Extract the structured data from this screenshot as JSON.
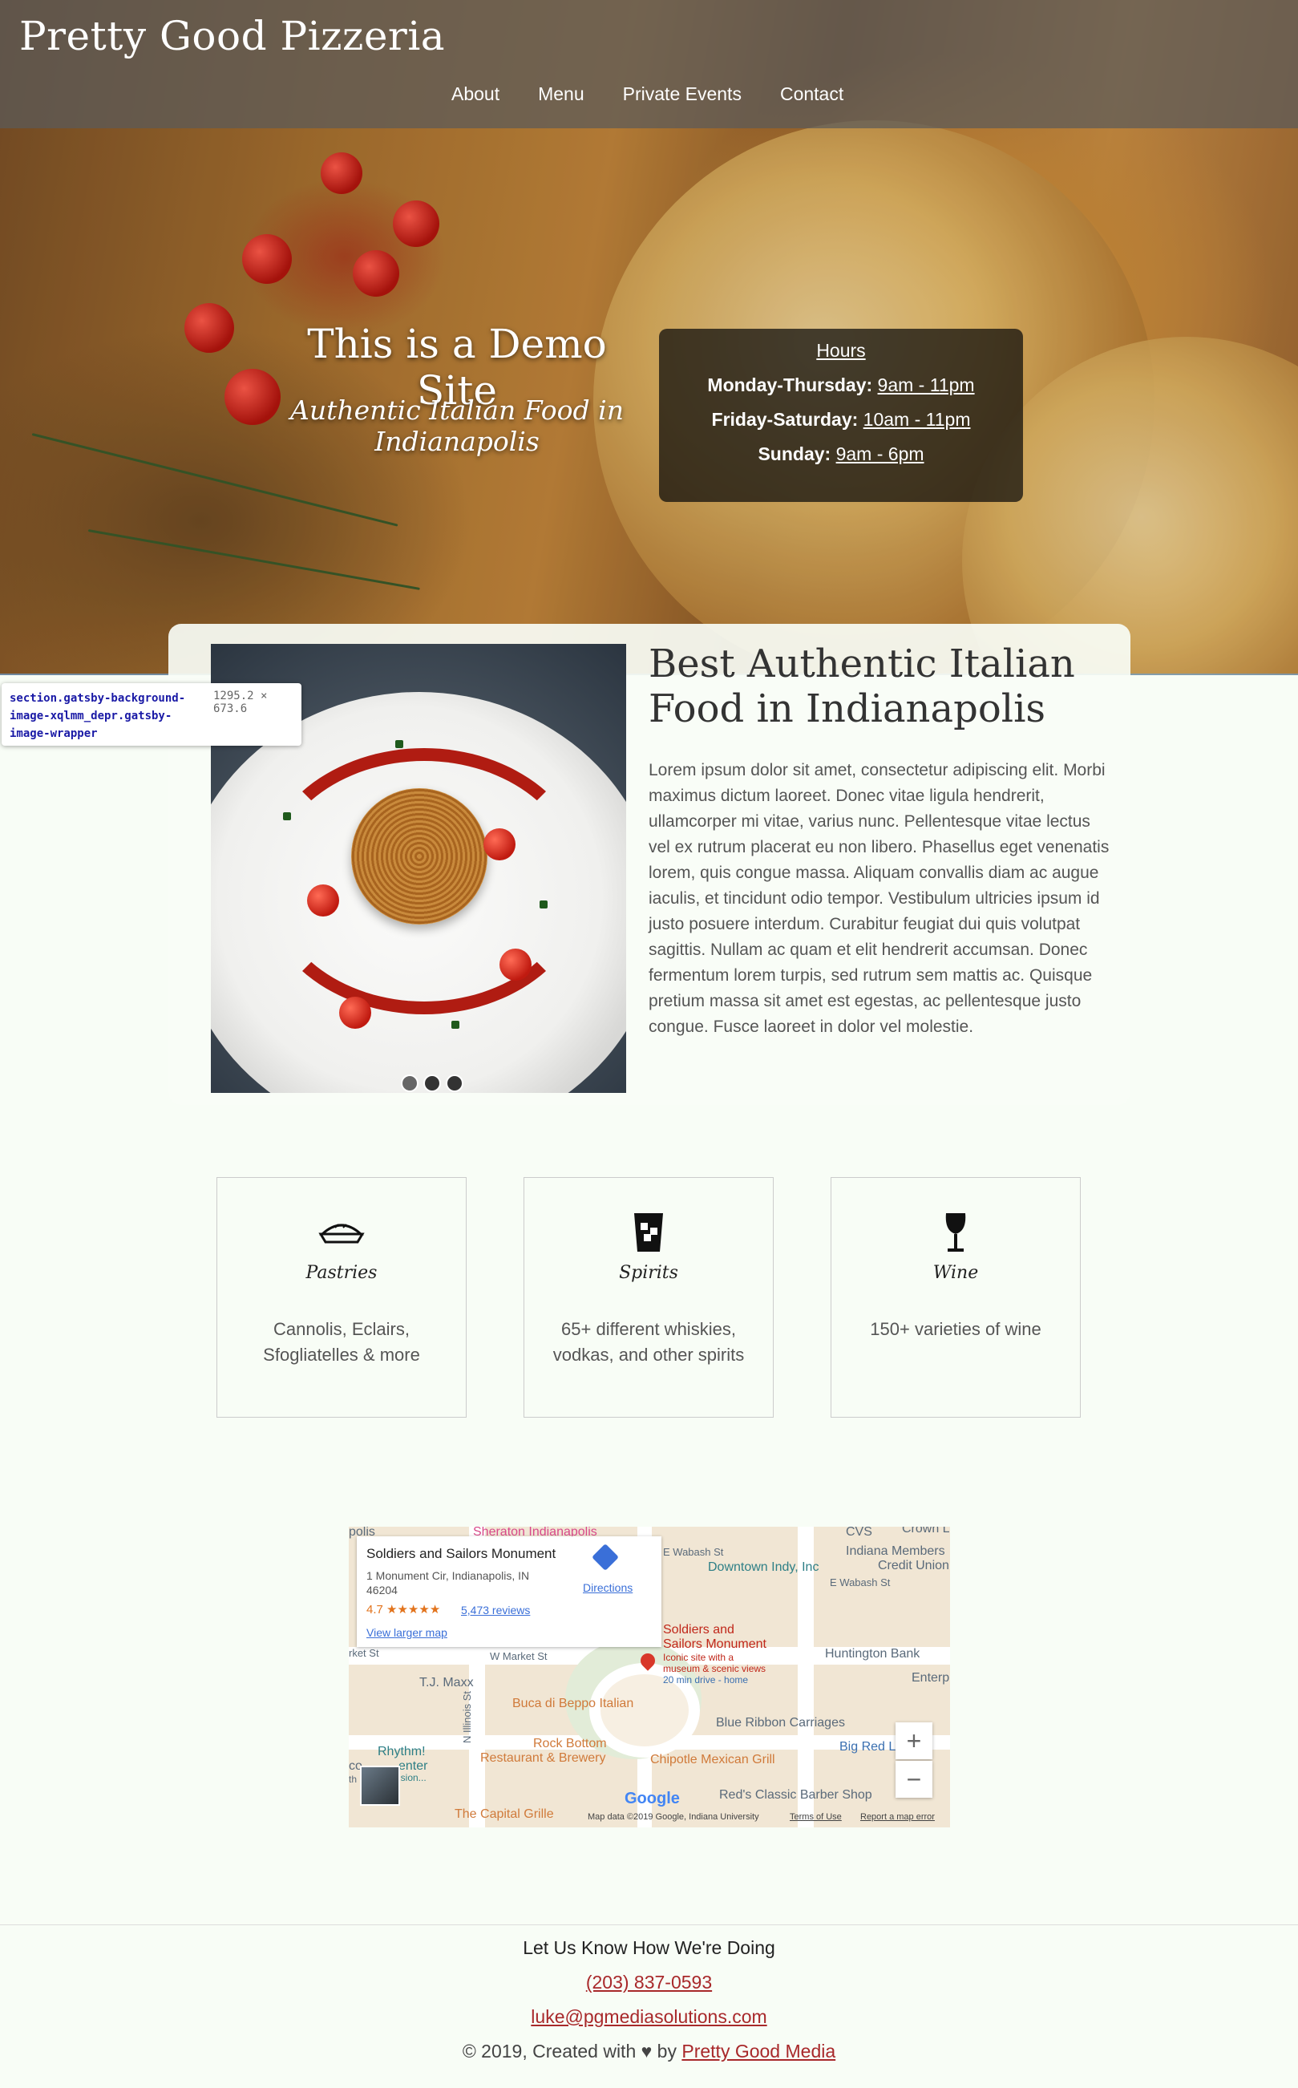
{
  "brand": "Pretty Good Pizzeria",
  "nav": [
    {
      "label": "About"
    },
    {
      "label": "Menu"
    },
    {
      "label": "Private Events"
    },
    {
      "label": "Contact"
    }
  ],
  "hero": {
    "title": "This is a Demo Site",
    "subtitle": "Authentic Italian Food in Indianapolis"
  },
  "hours": {
    "title": "Hours",
    "rows": [
      {
        "days": "Monday-Thursday:",
        "time": "9am - 11pm"
      },
      {
        "days": "Friday-Saturday:",
        "time": "10am - 11pm"
      },
      {
        "days": "Sunday:",
        "time": "9am - 6pm"
      }
    ]
  },
  "about": {
    "title": "Best Authentic Italian Food in Indianapolis",
    "body": "Lorem ipsum dolor sit amet, consectetur adipiscing elit. Morbi maximus dictum laoreet. Donec vitae ligula hendrerit, ullamcorper mi vitae, varius nunc. Pellentesque vitae lectus vel ex rutrum placerat eu non libero. Phasellus eget venenatis lorem, quis congue massa. Aliquam convallis diam ac augue iaculis, et tincidunt odio tempor. Vestibulum ultricies ipsum id justo posuere interdum. Curabitur feugiat dui quis volutpat sagittis. Nullam ac quam et elit hendrerit accumsan. Donec fermentum lorem turpis, sed rutrum sem mattis ac. Quisque pretium massa sit amet est egestas, ac pellentesque justo congue. Fusce laoreet in dolor vel molestie."
  },
  "inspector": {
    "selector": "section.gatsby-background-image-xqlmm_depr.gatsby-image-wrapper",
    "size": "1295.2 × 673.6"
  },
  "features": [
    {
      "icon": "pie-icon",
      "title": "Pastries",
      "desc": "Cannolis, Eclairs, Sfogliatelles & more"
    },
    {
      "icon": "whiskey-glass-icon",
      "title": "Spirits",
      "desc": "65+ different whiskies, vodkas, and other spirits"
    },
    {
      "icon": "wine-glass-icon",
      "title": "Wine",
      "desc": "150+ varieties of wine"
    }
  ],
  "map": {
    "place_name": "Soldiers and Sailors Monument",
    "address": "1 Monument Cir, Indianapolis, IN 46204",
    "rating": "4.7",
    "stars": "★★★★★",
    "reviews": "5,473 reviews",
    "directions": "Directions",
    "larger_map": "View larger map",
    "labels": {
      "sheraton": "Sheraton Indianapolis",
      "olis": "polis",
      "wabash1": "E Wabash St",
      "cvs": "CVS",
      "crown": "Crown L",
      "imcu1": "Indiana Members",
      "imcu2": "Credit Union",
      "downtown": "Downtown Indy, Inc",
      "wabash2": "E Wabash St",
      "ssm1": "Soldiers and",
      "ssm2": "Sailors Monument",
      "ssm3": "Iconic site with a",
      "ssm4": "museum & scenic views",
      "ssm5": "20 min drive - home",
      "huntington": "Huntington Bank",
      "enterp": "Enterp",
      "market": "W Market St",
      "rket": "rket St",
      "tjmaxx": "T.J. Maxx",
      "beppo": "Buca di Beppo Italian",
      "bluerib": "Blue Ribbon Carriages",
      "bigred": "Big Red Li",
      "rhythm": "Rhythm!",
      "enter": "enter",
      "ision": "ision...",
      "co": "co",
      "th": "th",
      "illinois": "N Illinois St",
      "rockbottom1": "Rock Bottom",
      "rockbottom2": "Restaurant & Brewery",
      "chipotle": "Chipotle Mexican Grill",
      "capital": "The Capital Grille",
      "barber": "Red's Classic Barber Shop"
    },
    "google": "Google",
    "attribution": "Map data ©2019 Google, Indiana University",
    "terms": "Terms of Use",
    "report": "Report a map error",
    "zoom_in": "+",
    "zoom_out": "−"
  },
  "footer": {
    "heading": "Let Us Know How We're Doing",
    "phone": "(203) 837-0593",
    "email": "luke@pgmediasolutions.com",
    "copyright": "© 2019, Created with ♥ by ",
    "credit": "Pretty Good Media"
  },
  "colors": {
    "page_bg": "#f8fdf6",
    "link_red": "#a8282a",
    "topbar": "#5a5a5a",
    "map_link_blue": "#3a6fd8"
  }
}
